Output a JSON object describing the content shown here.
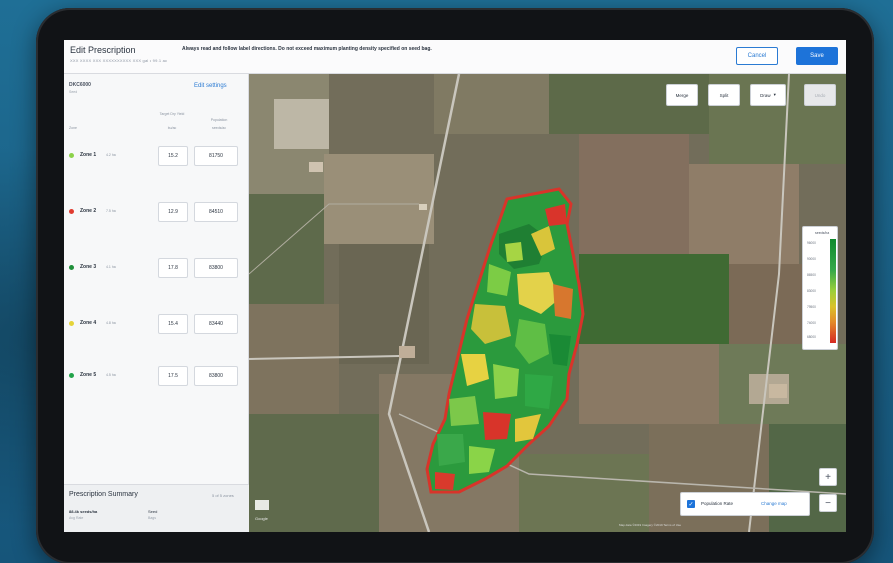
{
  "header": {
    "title": "Edit Prescription",
    "subtitle": "XXX XXXX XXX XXXXXXXXXX XXX gal • 99.1 ac",
    "notice": "Always read and follow label directions. Do not exceed maximum planting density specified on seed bag.",
    "cancel_label": "Cancel",
    "save_label": "Save"
  },
  "sidebar": {
    "field_name": "DKC6000",
    "field_sub": "Seed",
    "edit_settings": "Edit settings",
    "col_zone": "Zone",
    "col_yield": "Target Dry Yield",
    "col_yield_unit": "bu/ac",
    "col_population": "Population",
    "col_population_unit": "seeds/ac",
    "zones": [
      {
        "name": "Zone 1",
        "area": "4.2 ha",
        "color": "#8cd24a",
        "yield": "15.2",
        "population": "81750"
      },
      {
        "name": "Zone 2",
        "area": "7.5 ha",
        "color": "#e03b2f",
        "yield": "12.9",
        "population": "84510"
      },
      {
        "name": "Zone 3",
        "area": "4.1 ha",
        "color": "#1f8f3a",
        "yield": "17.8",
        "population": "83800"
      },
      {
        "name": "Zone 4",
        "area": "4.8 ha",
        "color": "#e5d43a",
        "yield": "15.4",
        "population": "83440"
      },
      {
        "name": "Zone 5",
        "area": "4.5 ha",
        "color": "#22a34a",
        "yield": "17.5",
        "population": "83800"
      }
    ],
    "summary_title": "Prescription Summary",
    "summary_right": "5 of 5 zones",
    "summary_value": "88.4k seeds/ha",
    "summary_value_sub": "Avg Rate",
    "summary_seed": "Seed",
    "summary_seed_sub": "Bags"
  },
  "map": {
    "buttons": [
      "Merge",
      "Split",
      "Draw",
      "Undo"
    ],
    "legend_title": "seeds/ha",
    "legend_ticks": [
      "68000",
      "74000",
      "79500",
      "83000",
      "86500",
      "90000",
      "96000"
    ],
    "zoom_in": "+",
    "zoom_out": "−",
    "population_label": "Population Rate",
    "change_map": "Change map",
    "google": "Google",
    "attribution": "Map data ©2019 Imagery ©2019 Terms of Use"
  },
  "colors": {
    "accent": "#1d73d9",
    "bg": "#1a5f84"
  }
}
